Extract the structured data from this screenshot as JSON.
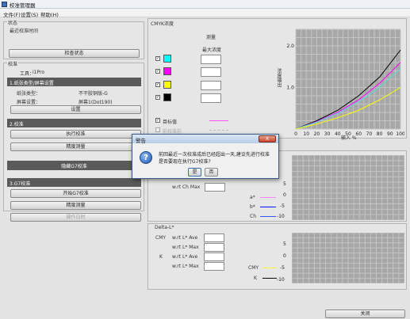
{
  "window": {
    "title": "校准管理器"
  },
  "menu": [
    "文件(F)",
    "设置(S)",
    "帮助(H)"
  ],
  "status_frame": {
    "label": "状态",
    "last_calibration": "最近校准时间",
    "check_button": "检查状态"
  },
  "calibration_frame": {
    "label": "校准",
    "tool_label": "工具：",
    "tool_value": "i1Pro",
    "step1": {
      "header": "1.纸张类型/屏幕设置",
      "paper_type_label": "纸张类型：",
      "paper_type_value": "不干胶铜版-G",
      "screen_label": "屏幕设置：",
      "screen_value": "屏幕1(Dot190)",
      "settings_button": "设置"
    },
    "step2": {
      "header": "2.校准",
      "run_button": "执行校准",
      "measure_button": "精度测量"
    },
    "hide_g7_button": "隐藏G7校准",
    "step3": {
      "header": "3.G7校准",
      "start_button": "开始G7校准",
      "measure_button": "精度测量",
      "disabled_button": "操作日时"
    }
  },
  "cmyk_panel": {
    "label": "CMYK浓度",
    "measure_header": "测量",
    "max_density_header": "最大浓度",
    "swatches": [
      {
        "name": "cyan",
        "color": "#00ffff"
      },
      {
        "name": "magenta",
        "color": "#ff00ff"
      },
      {
        "name": "yellow",
        "color": "#ffff00"
      },
      {
        "name": "black",
        "color": "#000000"
      }
    ],
    "legend": [
      {
        "label": "目标值",
        "color": "#ff55ff",
        "checked": true
      },
      {
        "label": "前校准前",
        "color": "#bbbbbb",
        "checked": false
      }
    ],
    "chart_ylabel": "浓度输出",
    "chart_xlabel": "输入 %"
  },
  "chart_data": [
    {
      "type": "line",
      "title": "",
      "xlabel": "输入 %",
      "ylabel": "浓度输出",
      "x_ticks": [
        "0",
        "10",
        "20",
        "30",
        "40",
        "50",
        "60",
        "70",
        "80",
        "90",
        "100"
      ],
      "y_ticks": [
        "1.0",
        "2.0"
      ],
      "xlim": [
        0,
        100
      ],
      "ylim": [
        0,
        2.4
      ],
      "series": [
        {
          "color": "#000000",
          "x": [
            0,
            20,
            40,
            60,
            80,
            100
          ],
          "y": [
            0,
            0.2,
            0.45,
            0.8,
            1.25,
            1.9
          ]
        },
        {
          "color": "#ff00ff",
          "x": [
            0,
            20,
            40,
            60,
            80,
            100
          ],
          "y": [
            0,
            0.18,
            0.4,
            0.7,
            1.1,
            1.6
          ]
        },
        {
          "color": "#55dddd",
          "x": [
            0,
            20,
            40,
            60,
            80,
            100
          ],
          "y": [
            0,
            0.17,
            0.38,
            0.65,
            1.0,
            1.45
          ]
        },
        {
          "color": "#ffff00",
          "x": [
            0,
            20,
            40,
            60,
            80,
            100
          ],
          "y": [
            0,
            0.12,
            0.27,
            0.45,
            0.7,
            1.0
          ]
        }
      ]
    }
  ],
  "gray_panel": {
    "field_label": "w.rt Ch Max",
    "legend": [
      "a*",
      "b*",
      "Ch"
    ],
    "legend_colors": [
      "#ff88ff",
      "#0000ff",
      "#3355ff"
    ],
    "y_ticks": [
      "5",
      "0",
      "-5",
      "-10"
    ]
  },
  "delta_panel": {
    "label": "Delta-L*",
    "cmy_label": "CMY",
    "k_label": "K",
    "rows": [
      "w.rt L* Ave",
      "w.rt L* Max",
      "w.rt L* Ave",
      "w.rt L* Max"
    ],
    "y_ticks": [
      "5",
      "0",
      "-5",
      "-10"
    ],
    "legend": [
      "CMY",
      "K"
    ],
    "legend_colors": [
      "#ffff33",
      "#000000"
    ]
  },
  "close_button": "关闭",
  "dialog": {
    "title": "警告",
    "close_glyph": "X",
    "message_line1": "前回最近一次校准成后已经超出一天,建议先进行校准",
    "message_line2": "是否要现在执行G7校准?",
    "yes": "是",
    "no": "否"
  }
}
